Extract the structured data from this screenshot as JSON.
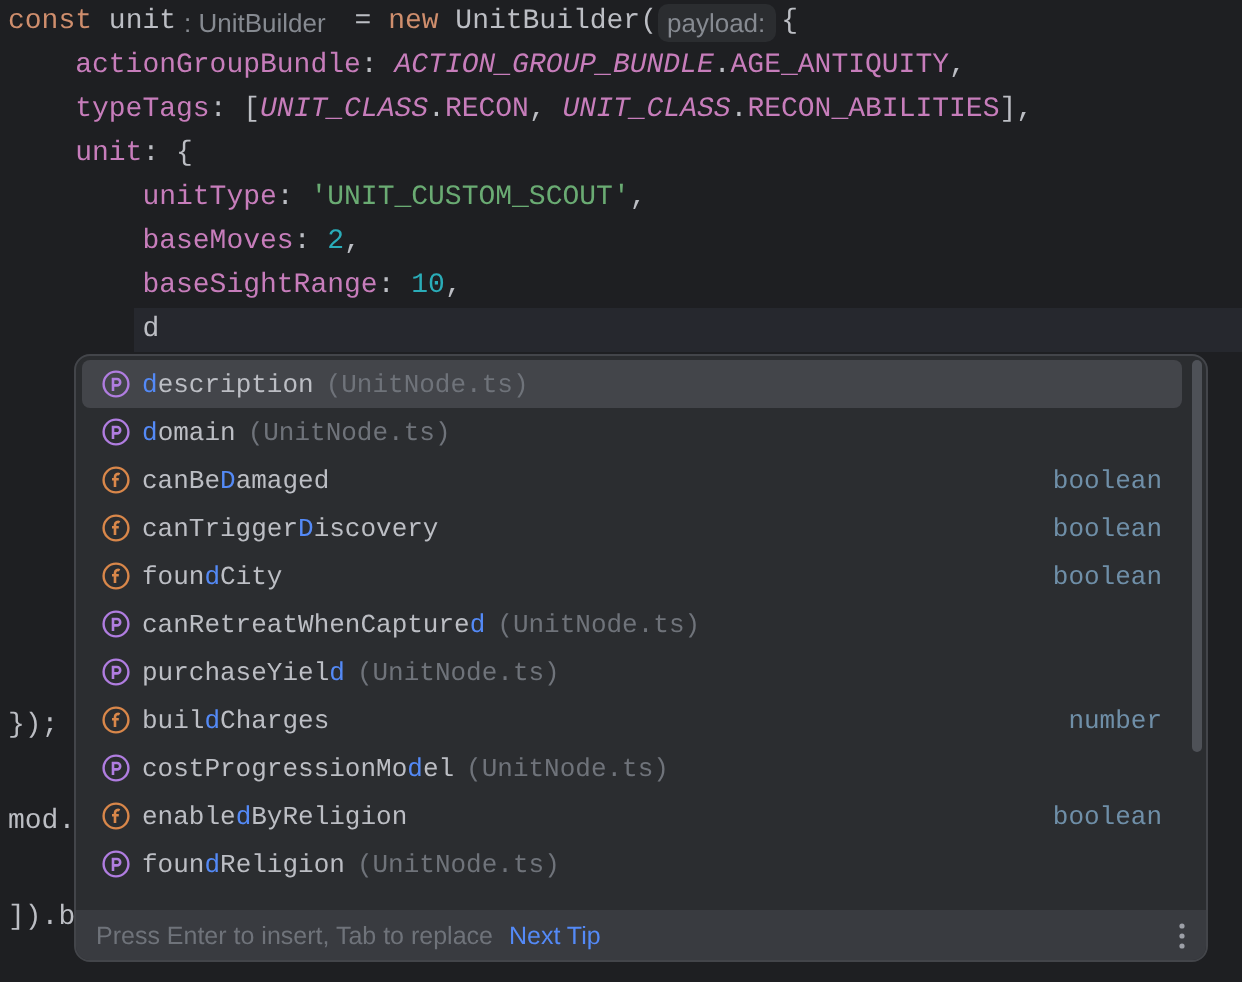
{
  "code": {
    "lines": [
      {
        "segments": [
          {
            "text": "const ",
            "kind": "keyword"
          },
          {
            "text": "unit",
            "kind": "plain"
          },
          {
            "text": ": UnitBuilder",
            "kind": "hint"
          },
          {
            "text": " = ",
            "kind": "plain"
          },
          {
            "text": "new ",
            "kind": "keyword"
          },
          {
            "text": "UnitBuilder(",
            "kind": "plain"
          },
          {
            "text": "payload:",
            "kind": "param_hint"
          },
          {
            "text": "{",
            "kind": "plain"
          }
        ],
        "children": [
          {
            "segments": [
              {
                "text": "actionGroupBundle",
                "kind": "property"
              },
              {
                "text": ": ",
                "kind": "plain"
              },
              {
                "text": "ACTION_GROUP_BUNDLE",
                "kind": "constant_italic"
              },
              {
                "text": ".",
                "kind": "plain"
              },
              {
                "text": "AGE_ANTIQUITY",
                "kind": "constant"
              },
              {
                "text": ",",
                "kind": "plain"
              }
            ]
          },
          {
            "segments": [
              {
                "text": "typeTags",
                "kind": "property"
              },
              {
                "text": ": [",
                "kind": "plain"
              },
              {
                "text": "UNIT_CLASS",
                "kind": "constant_italic"
              },
              {
                "text": ".",
                "kind": "plain"
              },
              {
                "text": "RECON",
                "kind": "constant"
              },
              {
                "text": ", ",
                "kind": "plain"
              },
              {
                "text": "UNIT_CLASS",
                "kind": "constant_italic"
              },
              {
                "text": ".",
                "kind": "plain"
              },
              {
                "text": "RECON_ABILITIES",
                "kind": "constant"
              },
              {
                "text": "],",
                "kind": "plain"
              }
            ]
          },
          {
            "segments": [
              {
                "text": "unit",
                "kind": "property"
              },
              {
                "text": ": {",
                "kind": "plain"
              }
            ],
            "children": [
              {
                "segments": [
                  {
                    "text": "unitType",
                    "kind": "property"
                  },
                  {
                    "text": ": ",
                    "kind": "plain"
                  },
                  {
                    "text": "'UNIT_CUSTOM_SCOUT'",
                    "kind": "string"
                  },
                  {
                    "text": ",",
                    "kind": "plain"
                  }
                ]
              },
              {
                "segments": [
                  {
                    "text": "baseMoves",
                    "kind": "property"
                  },
                  {
                    "text": ": ",
                    "kind": "plain"
                  },
                  {
                    "text": "2",
                    "kind": "number"
                  },
                  {
                    "text": ",",
                    "kind": "plain"
                  }
                ]
              },
              {
                "segments": [
                  {
                    "text": "baseSightRange",
                    "kind": "property"
                  },
                  {
                    "text": ": ",
                    "kind": "plain"
                  },
                  {
                    "text": "10",
                    "kind": "number"
                  },
                  {
                    "text": ",",
                    "kind": "plain"
                  }
                ]
              },
              {
                "segments": [
                  {
                    "text": "d",
                    "kind": "plain"
                  }
                ],
                "current": true
              }
            ]
          }
        ]
      }
    ],
    "lines_below_popup": [
      "});",
      "mod.",
      "]).b"
    ]
  },
  "completion": {
    "items": [
      {
        "kind": "property",
        "name_parts": {
          "match": "d",
          "after": "escription"
        },
        "source": "(UnitNode.ts)",
        "selected": true
      },
      {
        "kind": "property",
        "name_parts": {
          "match": "d",
          "after": "omain"
        },
        "source": "(UnitNode.ts)",
        "selected": false
      },
      {
        "kind": "field",
        "name_parts": {
          "before": "canBe",
          "match": "D",
          "after": "amaged"
        },
        "type": "boolean",
        "selected": false
      },
      {
        "kind": "field",
        "name_parts": {
          "before": "canTrigger",
          "match": "D",
          "after": "iscovery"
        },
        "type": "boolean",
        "selected": false
      },
      {
        "kind": "field",
        "name_parts": {
          "before": "foun",
          "match": "d",
          "after": "City"
        },
        "type": "boolean",
        "selected": false
      },
      {
        "kind": "property",
        "name_parts": {
          "before": "canRetreatWhenCapture",
          "match": "d"
        },
        "source": "(UnitNode.ts)",
        "selected": false
      },
      {
        "kind": "property",
        "name_parts": {
          "before": "purchaseYiel",
          "match": "d"
        },
        "source": "(UnitNode.ts)",
        "selected": false
      },
      {
        "kind": "field",
        "name_parts": {
          "before": "buil",
          "match": "d",
          "after": "Charges"
        },
        "type": "number",
        "selected": false
      },
      {
        "kind": "property",
        "name_parts": {
          "before": "costProgressionMo",
          "match": "d",
          "after": "el"
        },
        "source": "(UnitNode.ts)",
        "selected": false
      },
      {
        "kind": "field",
        "name_parts": {
          "before": "enable",
          "match": "d",
          "after": "ByReligion"
        },
        "type": "boolean",
        "selected": false
      },
      {
        "kind": "property",
        "name_parts": {
          "before": "foun",
          "match": "d",
          "after": "Religion"
        },
        "source": "(UnitNode.ts)",
        "selected": false
      }
    ],
    "footer": {
      "hint": "Press Enter to insert, Tab to replace",
      "link": "Next Tip"
    }
  }
}
